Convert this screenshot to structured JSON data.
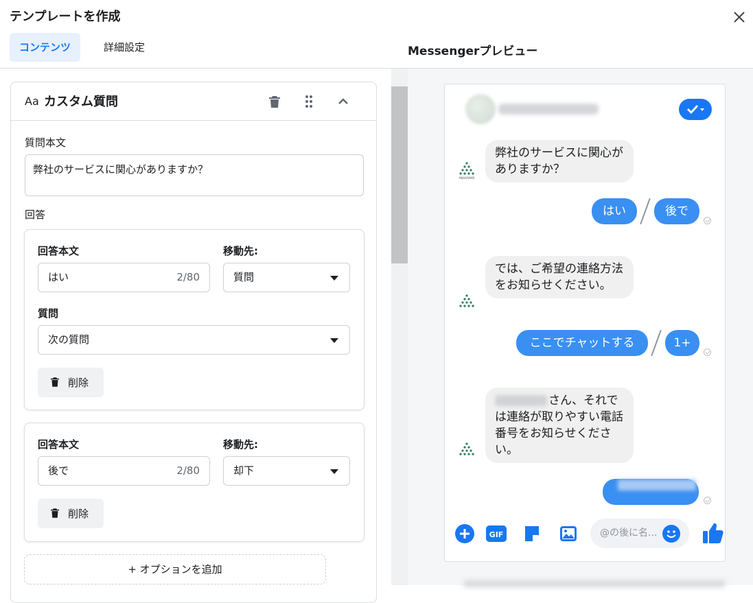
{
  "header": {
    "title": "テンプレートを作成",
    "tabs": [
      {
        "label": "コンテンツ",
        "active": true
      },
      {
        "label": "詳細設定",
        "active": false
      }
    ],
    "preview_title": "Messengerプレビュー"
  },
  "editor": {
    "card_prefix": "Aa",
    "card_title": "カスタム質問",
    "question_label": "質問本文",
    "question_value": "弊社のサービスに関心がありますか？",
    "answers_label": "回答",
    "options": [
      {
        "answer_label": "回答本文",
        "answer_value": "はい",
        "count": "2/80",
        "dest_label": "移動先:",
        "dest_value": "質問",
        "question_label": "質問",
        "question_value": "次の質問",
        "delete_label": "削除"
      },
      {
        "answer_label": "回答本文",
        "answer_value": "後で",
        "count": "2/80",
        "dest_label": "移動先:",
        "dest_value": "却下",
        "delete_label": "削除"
      }
    ],
    "add_option_label": "+ オプションを追加"
  },
  "preview": {
    "messages": [
      {
        "text": "弊社のサービスに関心がありますか？"
      },
      {
        "text": "では、ご希望の連絡方法をお知らせください。"
      },
      {
        "text": "さん、それでは連絡が取りやすい電話番号をお知らせください。"
      }
    ],
    "replies": [
      [
        "はい",
        "後で"
      ],
      [
        "ここでチャットする",
        "1+"
      ]
    ],
    "logo_caption": "ANAGRAMS",
    "composer": {
      "placeholder": "@の後に名...",
      "icons": [
        "plus-icon",
        "gif-icon",
        "sticker-icon",
        "image-icon",
        "emoji-icon",
        "thumbs-up-icon"
      ]
    }
  },
  "colors": {
    "accent": "#1877f2",
    "bubble_out": "#3a8ff2",
    "bubble_in": "#f0f0f0",
    "active_tab_bg": "#e7f0fd"
  }
}
